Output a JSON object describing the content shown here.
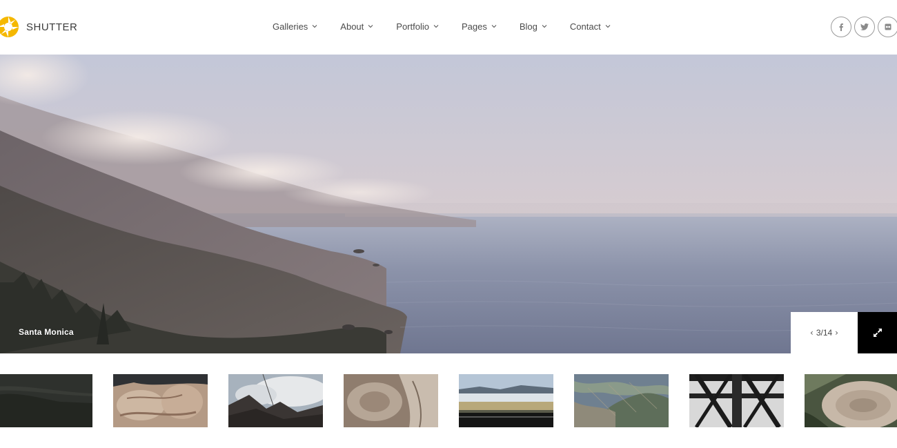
{
  "brand": {
    "name": "SHUTTER",
    "accent": "#f5b800"
  },
  "nav": {
    "items": [
      {
        "label": "Galleries"
      },
      {
        "label": "About"
      },
      {
        "label": "Portfolio"
      },
      {
        "label": "Pages"
      },
      {
        "label": "Blog"
      },
      {
        "label": "Contact"
      }
    ]
  },
  "social": {
    "facebook": "f",
    "twitter": "t",
    "flickr": "fl"
  },
  "slider": {
    "caption": "Santa Monica",
    "counter": "3/14",
    "prev_icon": "chevron-left-icon",
    "next_icon": "chevron-right-icon",
    "fullscreen_icon": "expand-icon"
  },
  "thumbnails": [
    {
      "name": "dark-coast"
    },
    {
      "name": "rock-formation"
    },
    {
      "name": "mountain-clouds"
    },
    {
      "name": "driftwood"
    },
    {
      "name": "valley-road"
    },
    {
      "name": "aerial-terrain"
    },
    {
      "name": "steel-bridge"
    },
    {
      "name": "tree-stump"
    }
  ]
}
